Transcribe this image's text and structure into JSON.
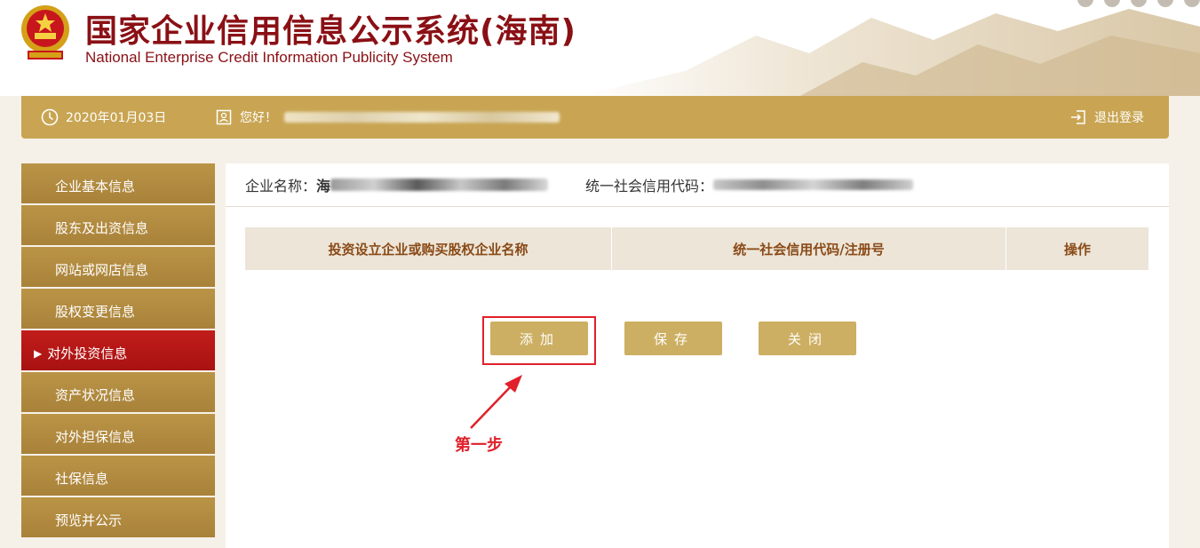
{
  "header": {
    "title_cn": "国家企业信用信息公示系统(海南)",
    "title_en": "National Enterprise Credit Information Publicity System"
  },
  "topbar": {
    "date": "2020年01月03日",
    "greeting": "您好！",
    "logout_label": "退出登录"
  },
  "sidebar": {
    "items": [
      {
        "label": "企业基本信息",
        "active": false
      },
      {
        "label": "股东及出资信息",
        "active": false
      },
      {
        "label": "网站或网店信息",
        "active": false
      },
      {
        "label": "股权变更信息",
        "active": false
      },
      {
        "label": "对外投资信息",
        "active": true
      },
      {
        "label": "资产状况信息",
        "active": false
      },
      {
        "label": "对外担保信息",
        "active": false
      },
      {
        "label": "社保信息",
        "active": false
      },
      {
        "label": "预览并公示",
        "active": false
      }
    ]
  },
  "info": {
    "company_label": "企业名称：",
    "company_partial": "海",
    "credit_code_label": "统一社会信用代码："
  },
  "table": {
    "headers": [
      "投资设立企业或购买股权企业名称",
      "统一社会信用代码/注册号",
      "操作"
    ]
  },
  "buttons": {
    "add": "添加",
    "save": "保存",
    "close": "关闭"
  },
  "annotation": {
    "step_text": "第一步"
  },
  "colors": {
    "gold": "#c9a553",
    "active_red": "#b3171a",
    "brand_red": "#8a1015",
    "annotation_red": "#e0202a"
  }
}
